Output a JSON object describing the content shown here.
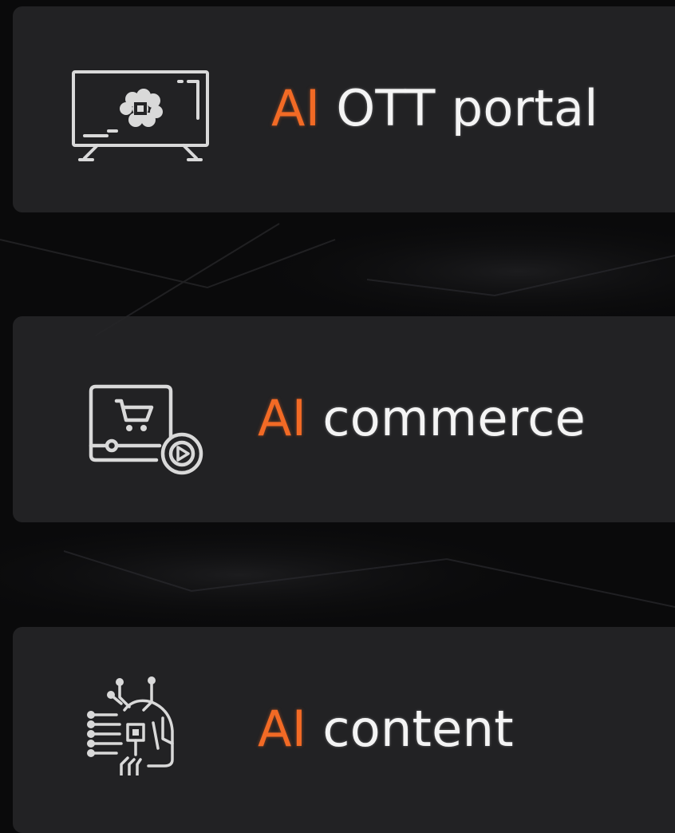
{
  "colors": {
    "background": "#0a0a0b",
    "card": "#242426",
    "accent": "#f26a25",
    "text": "#f4f4f4",
    "icon": "#d9d9d9"
  },
  "cards": [
    {
      "accent": "AI",
      "label": "OTT portal",
      "icon": "smart-tv-ai-brain-icon"
    },
    {
      "accent": "AI",
      "label": "commerce",
      "icon": "video-shopping-cart-icon"
    },
    {
      "accent": "AI",
      "label": "content",
      "icon": "robot-circuit-head-icon"
    }
  ]
}
